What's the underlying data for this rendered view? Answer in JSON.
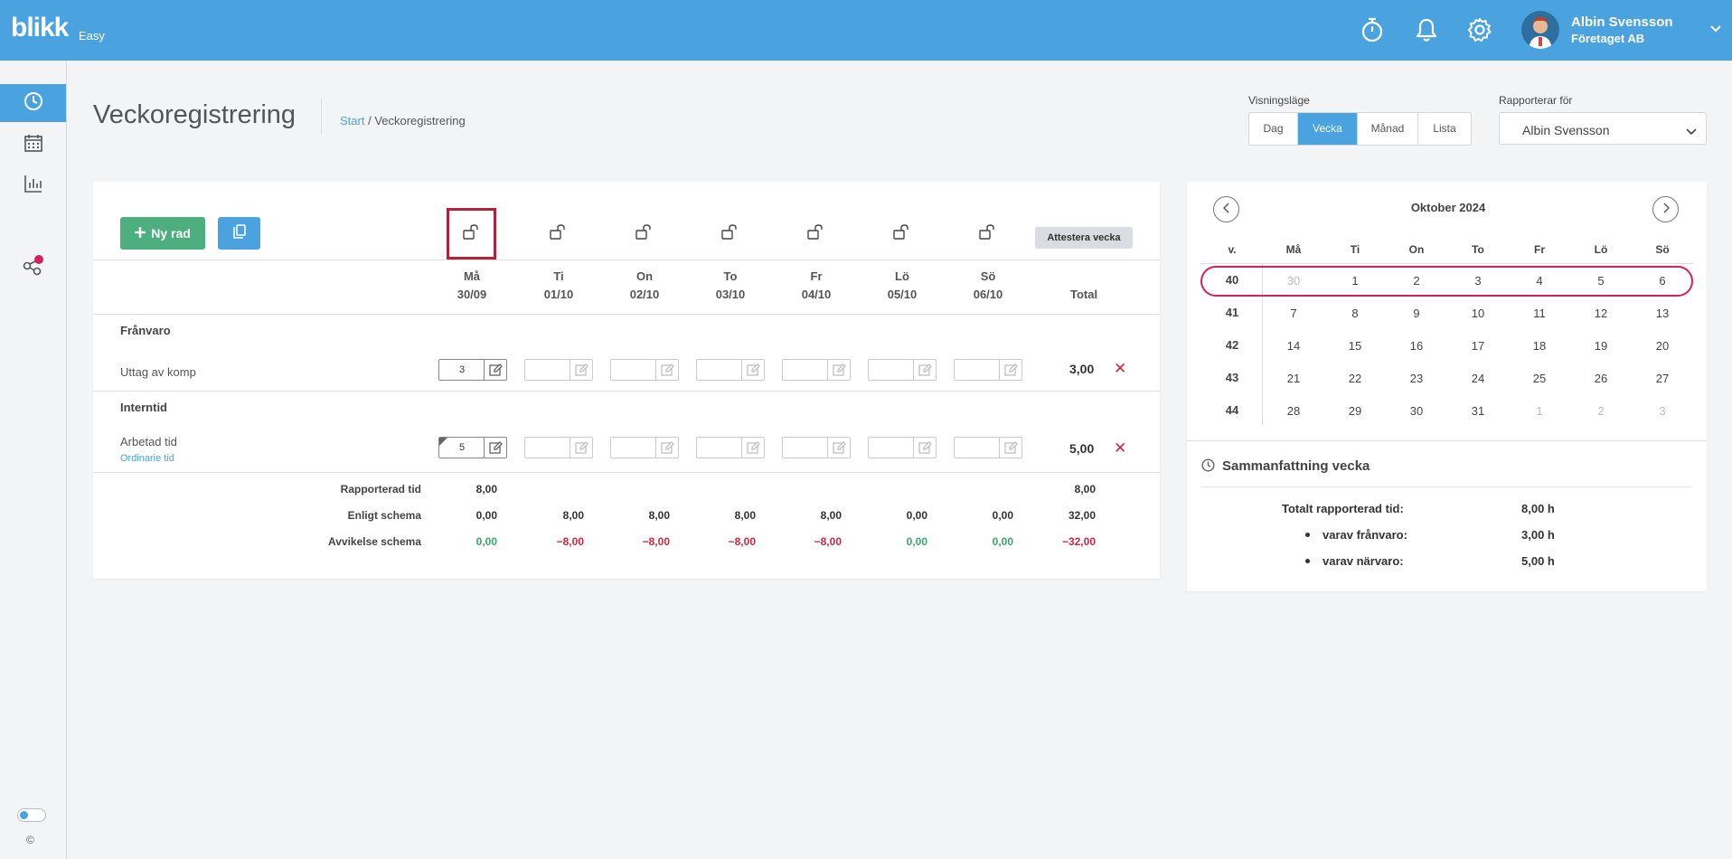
{
  "app": {
    "logo": "blikk",
    "logo_sub": "Easy"
  },
  "user": {
    "name": "Albin Svensson",
    "company": "Företaget AB"
  },
  "page": {
    "title": "Veckoregistrering",
    "breadcrumb_start": "Start",
    "breadcrumb_sep": " / ",
    "breadcrumb_current": "Veckoregistrering"
  },
  "view": {
    "label": "Visningsläge",
    "options": [
      "Dag",
      "Vecka",
      "Månad",
      "Lista"
    ],
    "selected": "Vecka"
  },
  "reporting": {
    "label": "Rapporterar för",
    "value": "Albin Svensson"
  },
  "toolbar": {
    "new_row": "Ny rad",
    "attest": "Attestera vecka"
  },
  "days": [
    {
      "name": "Må",
      "date": "30/09"
    },
    {
      "name": "Ti",
      "date": "01/10"
    },
    {
      "name": "On",
      "date": "02/10"
    },
    {
      "name": "To",
      "date": "03/10"
    },
    {
      "name": "Fr",
      "date": "04/10"
    },
    {
      "name": "Lö",
      "date": "05/10"
    },
    {
      "name": "Sö",
      "date": "06/10"
    }
  ],
  "total_header": "Total",
  "groups": [
    {
      "title": "Frånvaro",
      "rows": [
        {
          "label": "Uttag av komp",
          "sub": "",
          "values": [
            "3",
            "",
            "",
            "",
            "",
            "",
            ""
          ],
          "total": "3,00"
        }
      ]
    },
    {
      "title": "Interntid",
      "rows": [
        {
          "label": "Arbetad tid",
          "sub": "Ordinarie tid",
          "values": [
            "5",
            "",
            "",
            "",
            "",
            "",
            ""
          ],
          "total": "5,00"
        }
      ]
    }
  ],
  "summary": {
    "reported_label": "Rapporterad tid",
    "reported": [
      "8,00",
      "",
      "",
      "",
      "",
      "",
      ""
    ],
    "reported_total": "8,00",
    "schedule_label": "Enligt schema",
    "schedule": [
      "0,00",
      "8,00",
      "8,00",
      "8,00",
      "8,00",
      "0,00",
      "0,00"
    ],
    "schedule_total": "32,00",
    "deviation_label": "Avvikelse schema",
    "deviation": [
      "0,00",
      "−8,00",
      "−8,00",
      "−8,00",
      "−8,00",
      "0,00",
      "0,00"
    ],
    "deviation_total": "−32,00"
  },
  "calendar": {
    "title": "Oktober 2024",
    "week_header": "v.",
    "day_headers": [
      "Må",
      "Ti",
      "On",
      "To",
      "Fr",
      "Lö",
      "Sö"
    ],
    "weeks": [
      {
        "week": "40",
        "days": [
          "30",
          "1",
          "2",
          "3",
          "4",
          "5",
          "6"
        ]
      },
      {
        "week": "41",
        "days": [
          "7",
          "8",
          "9",
          "10",
          "11",
          "12",
          "13"
        ]
      },
      {
        "week": "42",
        "days": [
          "14",
          "15",
          "16",
          "17",
          "18",
          "19",
          "20"
        ]
      },
      {
        "week": "43",
        "days": [
          "21",
          "22",
          "23",
          "24",
          "25",
          "26",
          "27"
        ]
      },
      {
        "week": "44",
        "days": [
          "28",
          "29",
          "30",
          "31",
          "1",
          "2",
          "3"
        ]
      }
    ],
    "selected_week": "40"
  },
  "week_summary": {
    "title": "Sammanfattning vecka",
    "total_label": "Totalt rapporterad tid:",
    "total_value": "8,00 h",
    "absence_label": "varav frånvaro:",
    "absence_value": "3,00 h",
    "presence_label": "varav närvaro:",
    "presence_value": "5,00 h"
  },
  "footer": {
    "copyright": "©"
  },
  "colors": {
    "brand": "#4aa3df",
    "green": "#4caf7d",
    "red": "#d0263e",
    "highlight": "#b0243a"
  },
  "icons": [
    "stopwatch-icon",
    "bell-icon",
    "gear-icon",
    "clock-icon",
    "calendar-icon",
    "chart-icon",
    "share-icon",
    "lock-open-icon",
    "edit-icon",
    "copy-icon",
    "chevron-left-icon",
    "chevron-right-icon"
  ]
}
